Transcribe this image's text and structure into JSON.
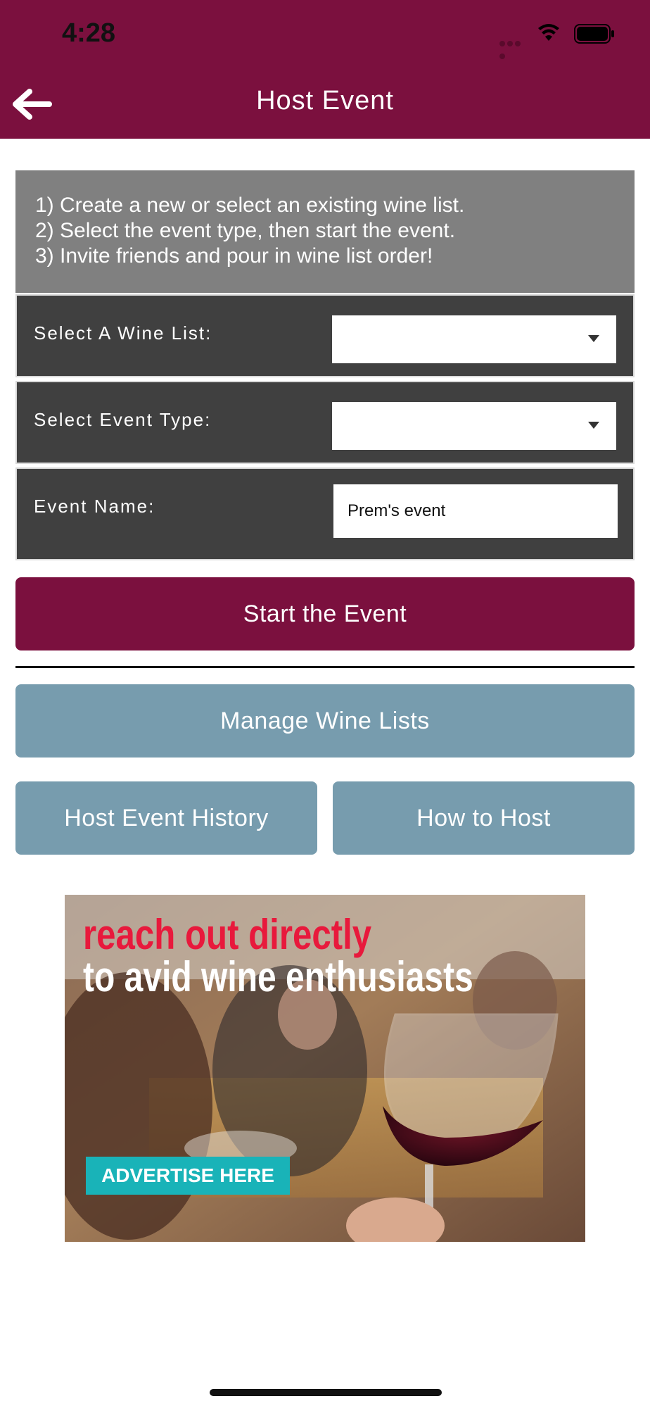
{
  "status_bar": {
    "time": "4:28"
  },
  "header": {
    "title": "Host Event",
    "back_icon": "arrow-left-icon",
    "background_color": "#7b103e"
  },
  "instructions": {
    "lines": [
      "1) Create a new or select an existing wine list.",
      "2) Select the event type, then start the event.",
      "3) Invite friends and pour in wine list order!"
    ]
  },
  "form": {
    "wine_list": {
      "label": "Select A Wine List:",
      "value": ""
    },
    "event_type": {
      "label": "Select Event Type:",
      "value": ""
    },
    "event_name": {
      "label": "Event Name:",
      "value": "Prem's event"
    }
  },
  "buttons": {
    "start_event": "Start the Event",
    "manage_wine_lists": "Manage Wine Lists",
    "host_event_history": "Host Event History",
    "how_to_host": "How to Host"
  },
  "ad": {
    "headline_red": "reach out directly",
    "headline_white": "to avid wine enthusiasts",
    "cta": "ADVERTISE HERE"
  }
}
